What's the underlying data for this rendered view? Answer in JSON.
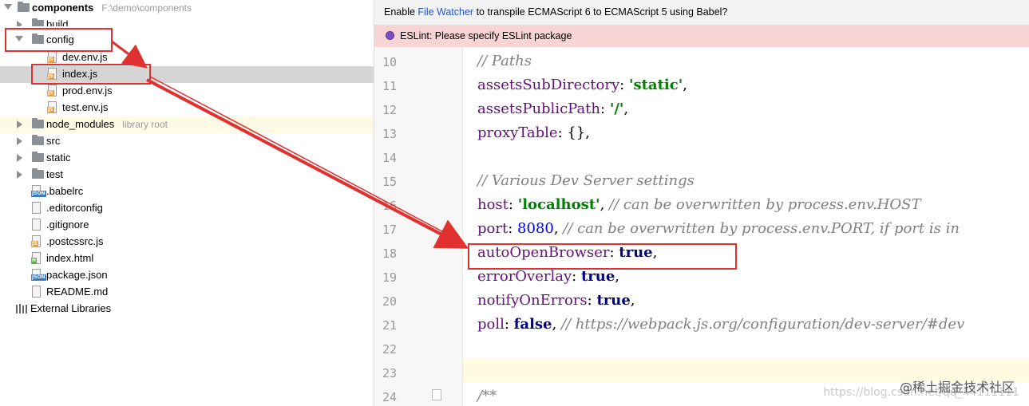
{
  "tree": {
    "root_name": "components",
    "root_path": "F:\\demo\\components",
    "items": [
      {
        "label": "build"
      },
      {
        "label": "config"
      },
      {
        "label": "dev.env.js"
      },
      {
        "label": "index.js"
      },
      {
        "label": "prod.env.js"
      },
      {
        "label": "test.env.js"
      },
      {
        "label": "node_modules",
        "hint": "library root"
      },
      {
        "label": "src"
      },
      {
        "label": "static"
      },
      {
        "label": "test"
      },
      {
        "label": ".babelrc"
      },
      {
        "label": ".editorconfig"
      },
      {
        "label": ".gitignore"
      },
      {
        "label": ".postcssrc.js"
      },
      {
        "label": "index.html"
      },
      {
        "label": "package.json"
      },
      {
        "label": "README.md"
      },
      {
        "label": "External Libraries"
      }
    ]
  },
  "editor": {
    "banner_prefix": "Enable ",
    "banner_link": "File Watcher",
    "banner_suffix": " to transpile ECMAScript 6 to ECMAScript 5 using Babel?",
    "eslint_warning": "ESLint: Please specify ESLint package",
    "line_numbers": [
      "10",
      "11",
      "12",
      "13",
      "14",
      "15",
      "16",
      "17",
      "18",
      "19",
      "20",
      "21",
      "22",
      "23",
      "24"
    ]
  },
  "code": {
    "l10_comment": "// Paths",
    "l11_key": "assetsSubDirectory",
    "l11_val": "'static'",
    "l12_key": "assetsPublicPath",
    "l12_val": "'/'",
    "l13_key": "proxyTable",
    "l13_val": "{}",
    "l15_comment": "// Various Dev Server settings",
    "l16_key": "host",
    "l16_val": "'localhost'",
    "l16_comment": "// can be overwritten by process.env.HOST",
    "l17_key": "port",
    "l17_val": "8080",
    "l17_comment": "// can be overwritten by process.env.PORT, if port is in",
    "l18_key": "autoOpenBrowser",
    "l18_val": "true",
    "l19_key": "errorOverlay",
    "l19_val": "true",
    "l20_key": "notifyOnErrors",
    "l20_val": "true",
    "l21_key": "poll",
    "l21_val": "false",
    "l21_comment": "// https://webpack.js.org/configuration/dev-server/#dev",
    "l24_comment": "/**"
  },
  "watermark": {
    "brand": "@稀土掘金技术社区",
    "url": "https://blog.csdn.net/qq_44111111"
  },
  "colors": {
    "highlight_row": "#d5d5d5",
    "node_modules_row": "#fdfbe5",
    "annotation_red": "#e03030"
  }
}
